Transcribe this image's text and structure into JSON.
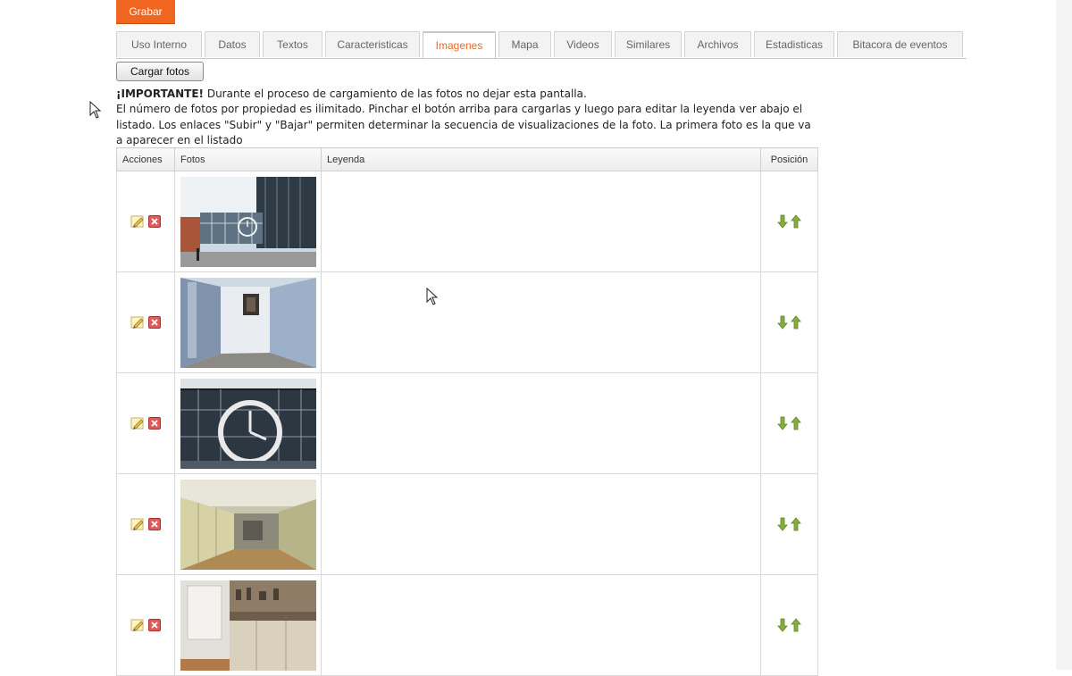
{
  "toolbar": {
    "save_label": "Grabar",
    "save_color": "#f0651f"
  },
  "tabs": [
    {
      "label": "Uso Interno",
      "active": false
    },
    {
      "label": "Datos",
      "active": false
    },
    {
      "label": "Textos",
      "active": false
    },
    {
      "label": "Caracteristicas",
      "active": false
    },
    {
      "label": "Imagenes",
      "active": true
    },
    {
      "label": "Mapa",
      "active": false
    },
    {
      "label": "Videos",
      "active": false
    },
    {
      "label": "Similares",
      "active": false
    },
    {
      "label": "Archivos",
      "active": false
    },
    {
      "label": "Estadisticas",
      "active": false
    },
    {
      "label": "Bitacora de eventos",
      "active": false
    }
  ],
  "active_tab_color": "#e86a25",
  "upload": {
    "label": "Cargar fotos"
  },
  "notice": {
    "strong": "¡IMPORTANTE!",
    "line1": " Durante el proceso de cargamiento de las fotos no dejar esta pantalla.",
    "line2": "El número de fotos por propiedad es ilimitado. Pinchar el botón arriba para cargarlas y luego para editar la leyenda ver abajo el",
    "line3": "listado. Los enlaces \"Subir\" y \"Bajar\" permiten determinar la secuencia de visualizaciones de la foto. La primera foto es la que va",
    "line4": "a aparecer en el listado"
  },
  "table": {
    "headers": {
      "actions": "Acciones",
      "photos": "Fotos",
      "caption": "Leyenda",
      "position": "Posición"
    },
    "rows": [
      {
        "photo": "building-exterior-photo",
        "caption": ""
      },
      {
        "photo": "hallway-photo",
        "caption": ""
      },
      {
        "photo": "wall-clock-photo",
        "caption": ""
      },
      {
        "photo": "kitchen-photo",
        "caption": ""
      },
      {
        "photo": "kitchen-counter-photo",
        "caption": ""
      }
    ]
  },
  "icons": {
    "edit": "pencil-icon",
    "delete": "delete-icon",
    "move_down": "arrow-down-icon",
    "move_up": "arrow-up-icon"
  },
  "colors": {
    "arrow_green": "#7aa33a",
    "delete_red": "#d9534f"
  }
}
